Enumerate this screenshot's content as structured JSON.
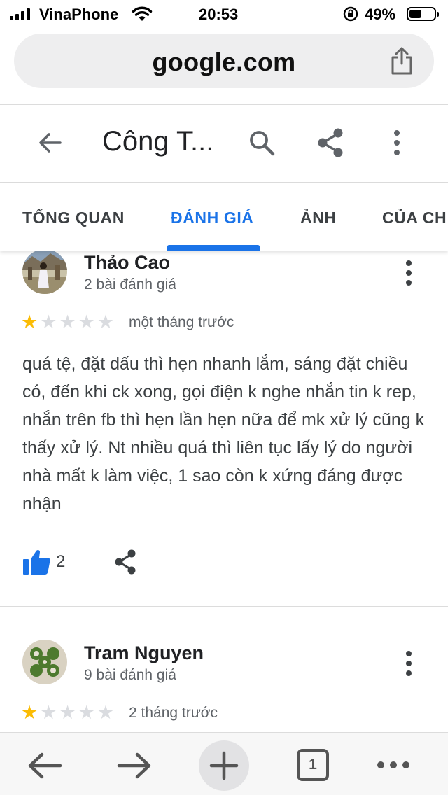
{
  "status_bar": {
    "carrier": "VinaPhone",
    "time": "20:53",
    "battery_percent": "49%",
    "battery_level": 0.49
  },
  "browser": {
    "url": "google.com"
  },
  "header": {
    "title": "Công T..."
  },
  "tabs": [
    {
      "label": "TỔNG QUAN"
    },
    {
      "label": "ĐÁNH GIÁ",
      "active": true
    },
    {
      "label": "ẢNH"
    },
    {
      "label": "CỦA CH"
    }
  ],
  "reviews": [
    {
      "name": "Thảo Cao",
      "review_count": "2 bài đánh giá",
      "rating": 1,
      "max_rating": 5,
      "time": "một tháng trước",
      "text": "quá tệ, đặt dấu thì hẹn nhanh lắm, sáng đặt chiều có, đến khi ck xong, gọi điện k nghe nhắn tin k rep, nhắn trên fb thì hẹn lần hẹn nữa để mk xử lý cũng k thấy xử lý. Nt nhiều quá thì liên tục lấy lý do người nhà mất k làm việc, 1 sao còn k xứng đáng được nhận",
      "likes": "2"
    },
    {
      "name": "Tram Nguyen",
      "review_count": "9 bài đánh giá",
      "rating": 1,
      "max_rating": 5,
      "time": "2 tháng trước"
    }
  ],
  "bottom_toolbar": {
    "open_tabs": "1"
  },
  "colors": {
    "accent": "#1a73e8",
    "star_filled": "#fbbc04",
    "star_empty": "#dadce0",
    "like": "#1a73e8"
  }
}
